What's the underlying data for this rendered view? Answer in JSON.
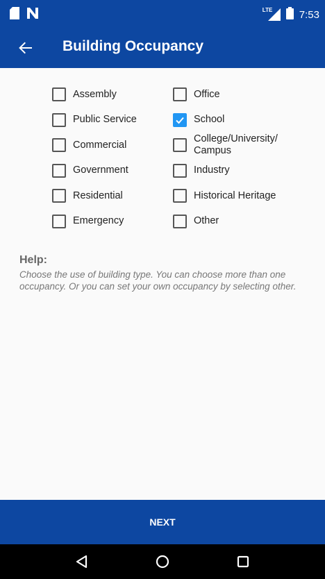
{
  "status_bar": {
    "time": "7:53",
    "network_label": "LTE",
    "icons": [
      "sd-card-icon",
      "n-notification-icon",
      "lte-signal-icon",
      "battery-icon"
    ]
  },
  "app_bar": {
    "title": "Building Occupancy",
    "back_icon": "arrow-back-icon"
  },
  "occupancy": {
    "left_column": [
      {
        "label": "Assembly",
        "checked": false
      },
      {
        "label": "Public Service",
        "checked": false
      },
      {
        "label": "Commercial",
        "checked": false
      },
      {
        "label": "Government",
        "checked": false
      },
      {
        "label": "Residential",
        "checked": false
      },
      {
        "label": "Emergency",
        "checked": false
      }
    ],
    "right_column": [
      {
        "label": "Office",
        "checked": false
      },
      {
        "label": "School",
        "checked": true
      },
      {
        "label": "College/University/\nCampus",
        "checked": false
      },
      {
        "label": "Industry",
        "checked": false
      },
      {
        "label": "Historical Heritage",
        "checked": false
      },
      {
        "label": "Other",
        "checked": false
      }
    ]
  },
  "help": {
    "title": "Help:",
    "text": "Choose the use of building type. You can choose more than one occupancy. Or you can set your own occupancy by selecting other."
  },
  "footer": {
    "next_label": "NEXT"
  },
  "nav_bar": {
    "icons": [
      "back-triangle-icon",
      "home-circle-icon",
      "recents-square-icon"
    ]
  },
  "colors": {
    "primary": "#0d47a1",
    "checkbox_checked": "#2196f3",
    "background": "#fafafa"
  }
}
